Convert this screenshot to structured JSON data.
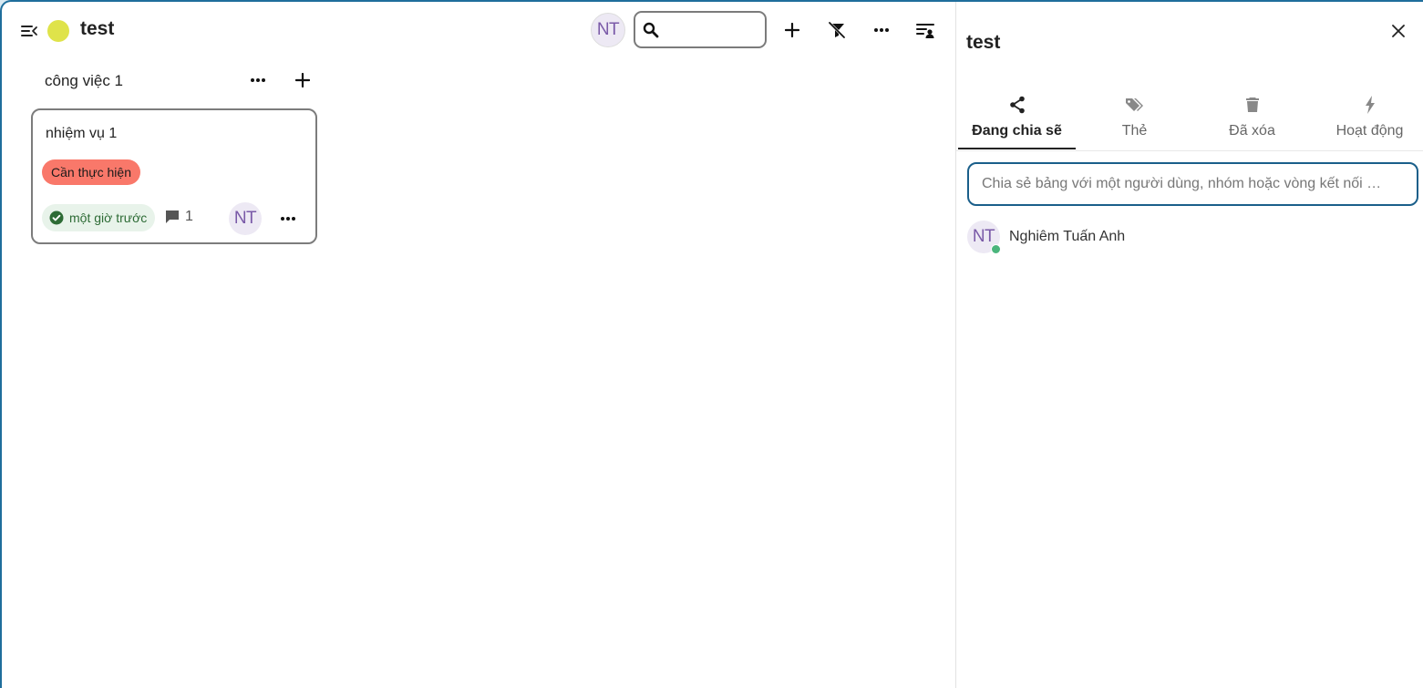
{
  "header": {
    "board_title": "test",
    "board_color": "#dfe34a",
    "user_initials": "NT",
    "search_placeholder": ""
  },
  "stack": {
    "title": "công việc 1",
    "cards": [
      {
        "title": "nhiệm vụ 1",
        "tag": "Cần thực hiện",
        "tag_color": "#f9786a",
        "due": "một giờ trước",
        "comment_count": "1",
        "assignee_initials": "NT"
      }
    ]
  },
  "sidebar": {
    "title": "test",
    "tabs": [
      {
        "label": "Đang chia sẽ",
        "icon": "share-icon"
      },
      {
        "label": "Thẻ",
        "icon": "tag-icon"
      },
      {
        "label": "Đã xóa",
        "icon": "trash-icon"
      },
      {
        "label": "Hoạt động",
        "icon": "lightning-icon"
      }
    ],
    "share_placeholder": "Chia sẻ bảng với một người dùng, nhóm hoặc vòng kết nối …",
    "sharees": [
      {
        "initials": "NT",
        "name": "Nghiêm Tuấn Anh"
      }
    ]
  }
}
